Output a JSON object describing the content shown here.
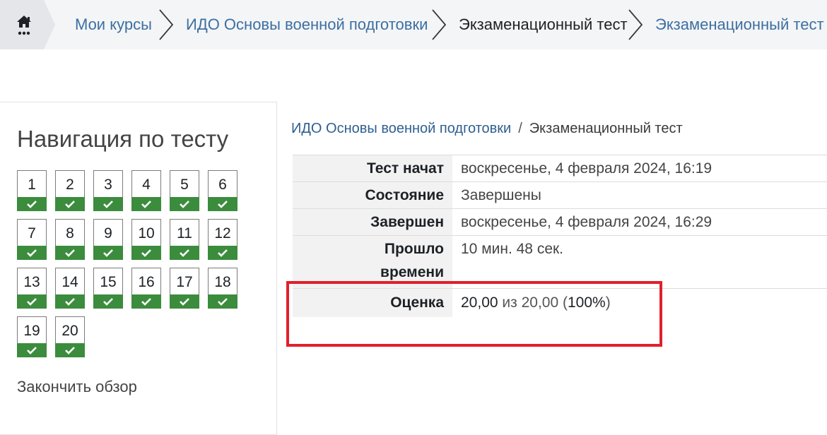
{
  "breadcrumb": {
    "items": [
      {
        "label": "Мои курсы",
        "type": "link"
      },
      {
        "label": "ИДО Основы военной подготовки",
        "type": "link"
      },
      {
        "label": "Экзаменационный тест",
        "type": "current"
      },
      {
        "label": "Экзаменационный тест",
        "type": "link"
      }
    ],
    "home_icon": "home-icon"
  },
  "nav": {
    "title": "Навигация по тесту",
    "questions": [
      "1",
      "2",
      "3",
      "4",
      "5",
      "6",
      "7",
      "8",
      "9",
      "10",
      "11",
      "12",
      "13",
      "14",
      "15",
      "16",
      "17",
      "18",
      "19",
      "20"
    ],
    "status": "correct",
    "status_color": "#3b8c3d",
    "finish_review": "Закончить обзор"
  },
  "path": {
    "course": "ИДО Основы военной подготовки",
    "separator": "/",
    "quiz": "Экзаменационный тест"
  },
  "summary": {
    "started_label": "Тест начат",
    "started_value": "воскресенье, 4 февраля 2024, 16:19",
    "state_label": "Состояние",
    "state_value": "Завершены",
    "completed_label": "Завершен",
    "completed_value": "воскресенье, 4 февраля 2024, 16:29",
    "time_label_1": "Прошло",
    "time_label_2": "времени",
    "time_value": "10 мин. 48 сек.",
    "grade_label": "Оценка",
    "grade_score": "20,00",
    "grade_of": "из 20,00",
    "grade_open": "(",
    "grade_percent": "100%",
    "grade_close": ")"
  },
  "highlight_color": "#e0202a"
}
